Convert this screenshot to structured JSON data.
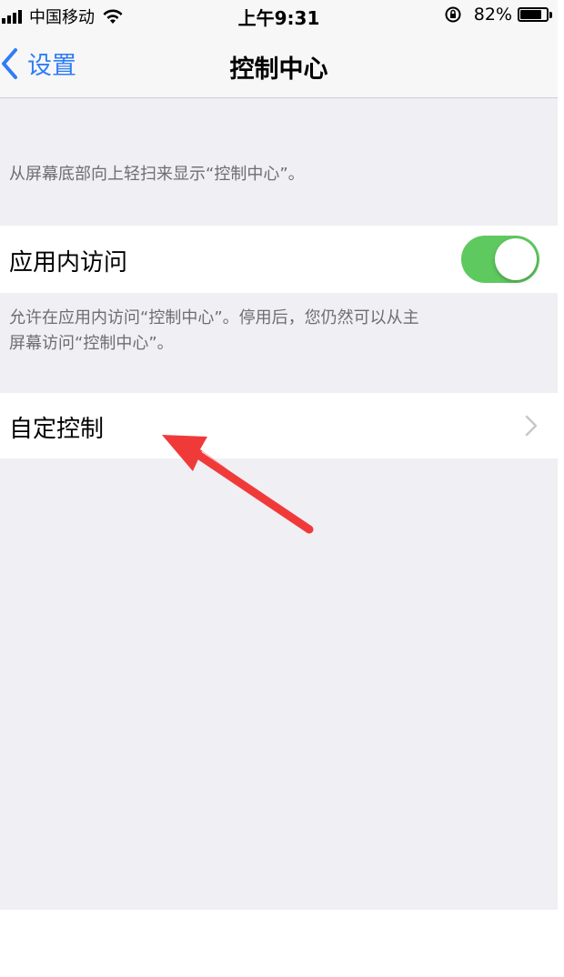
{
  "status_bar": {
    "carrier": "中国移动",
    "time": "上午9:31",
    "battery": "82%",
    "battery_level": 0.82,
    "signal_icon": "signal-icon",
    "wifi_icon": "wifi-icon",
    "rotation_lock_icon": "rotation-lock-icon"
  },
  "nav": {
    "back_label": "设置",
    "title": "控制中心"
  },
  "content": {
    "intro_text": "从屏幕底部向上轻扫来显示“控制中心”。",
    "in_app_access_label": "应用内访问",
    "in_app_access_on": true,
    "in_app_access_footer_line1": "允许在应用内访问“控制中心”。停用后，您仍然可以从主",
    "in_app_access_footer_line2": "屏幕访问“控制中心”。",
    "customize_label": "自定控制"
  },
  "colors": {
    "toggle_on": "#5ec95f",
    "accent_blue": "#2f7df6",
    "annotation_arrow": "#f03a3a",
    "background": "#efeff4"
  }
}
